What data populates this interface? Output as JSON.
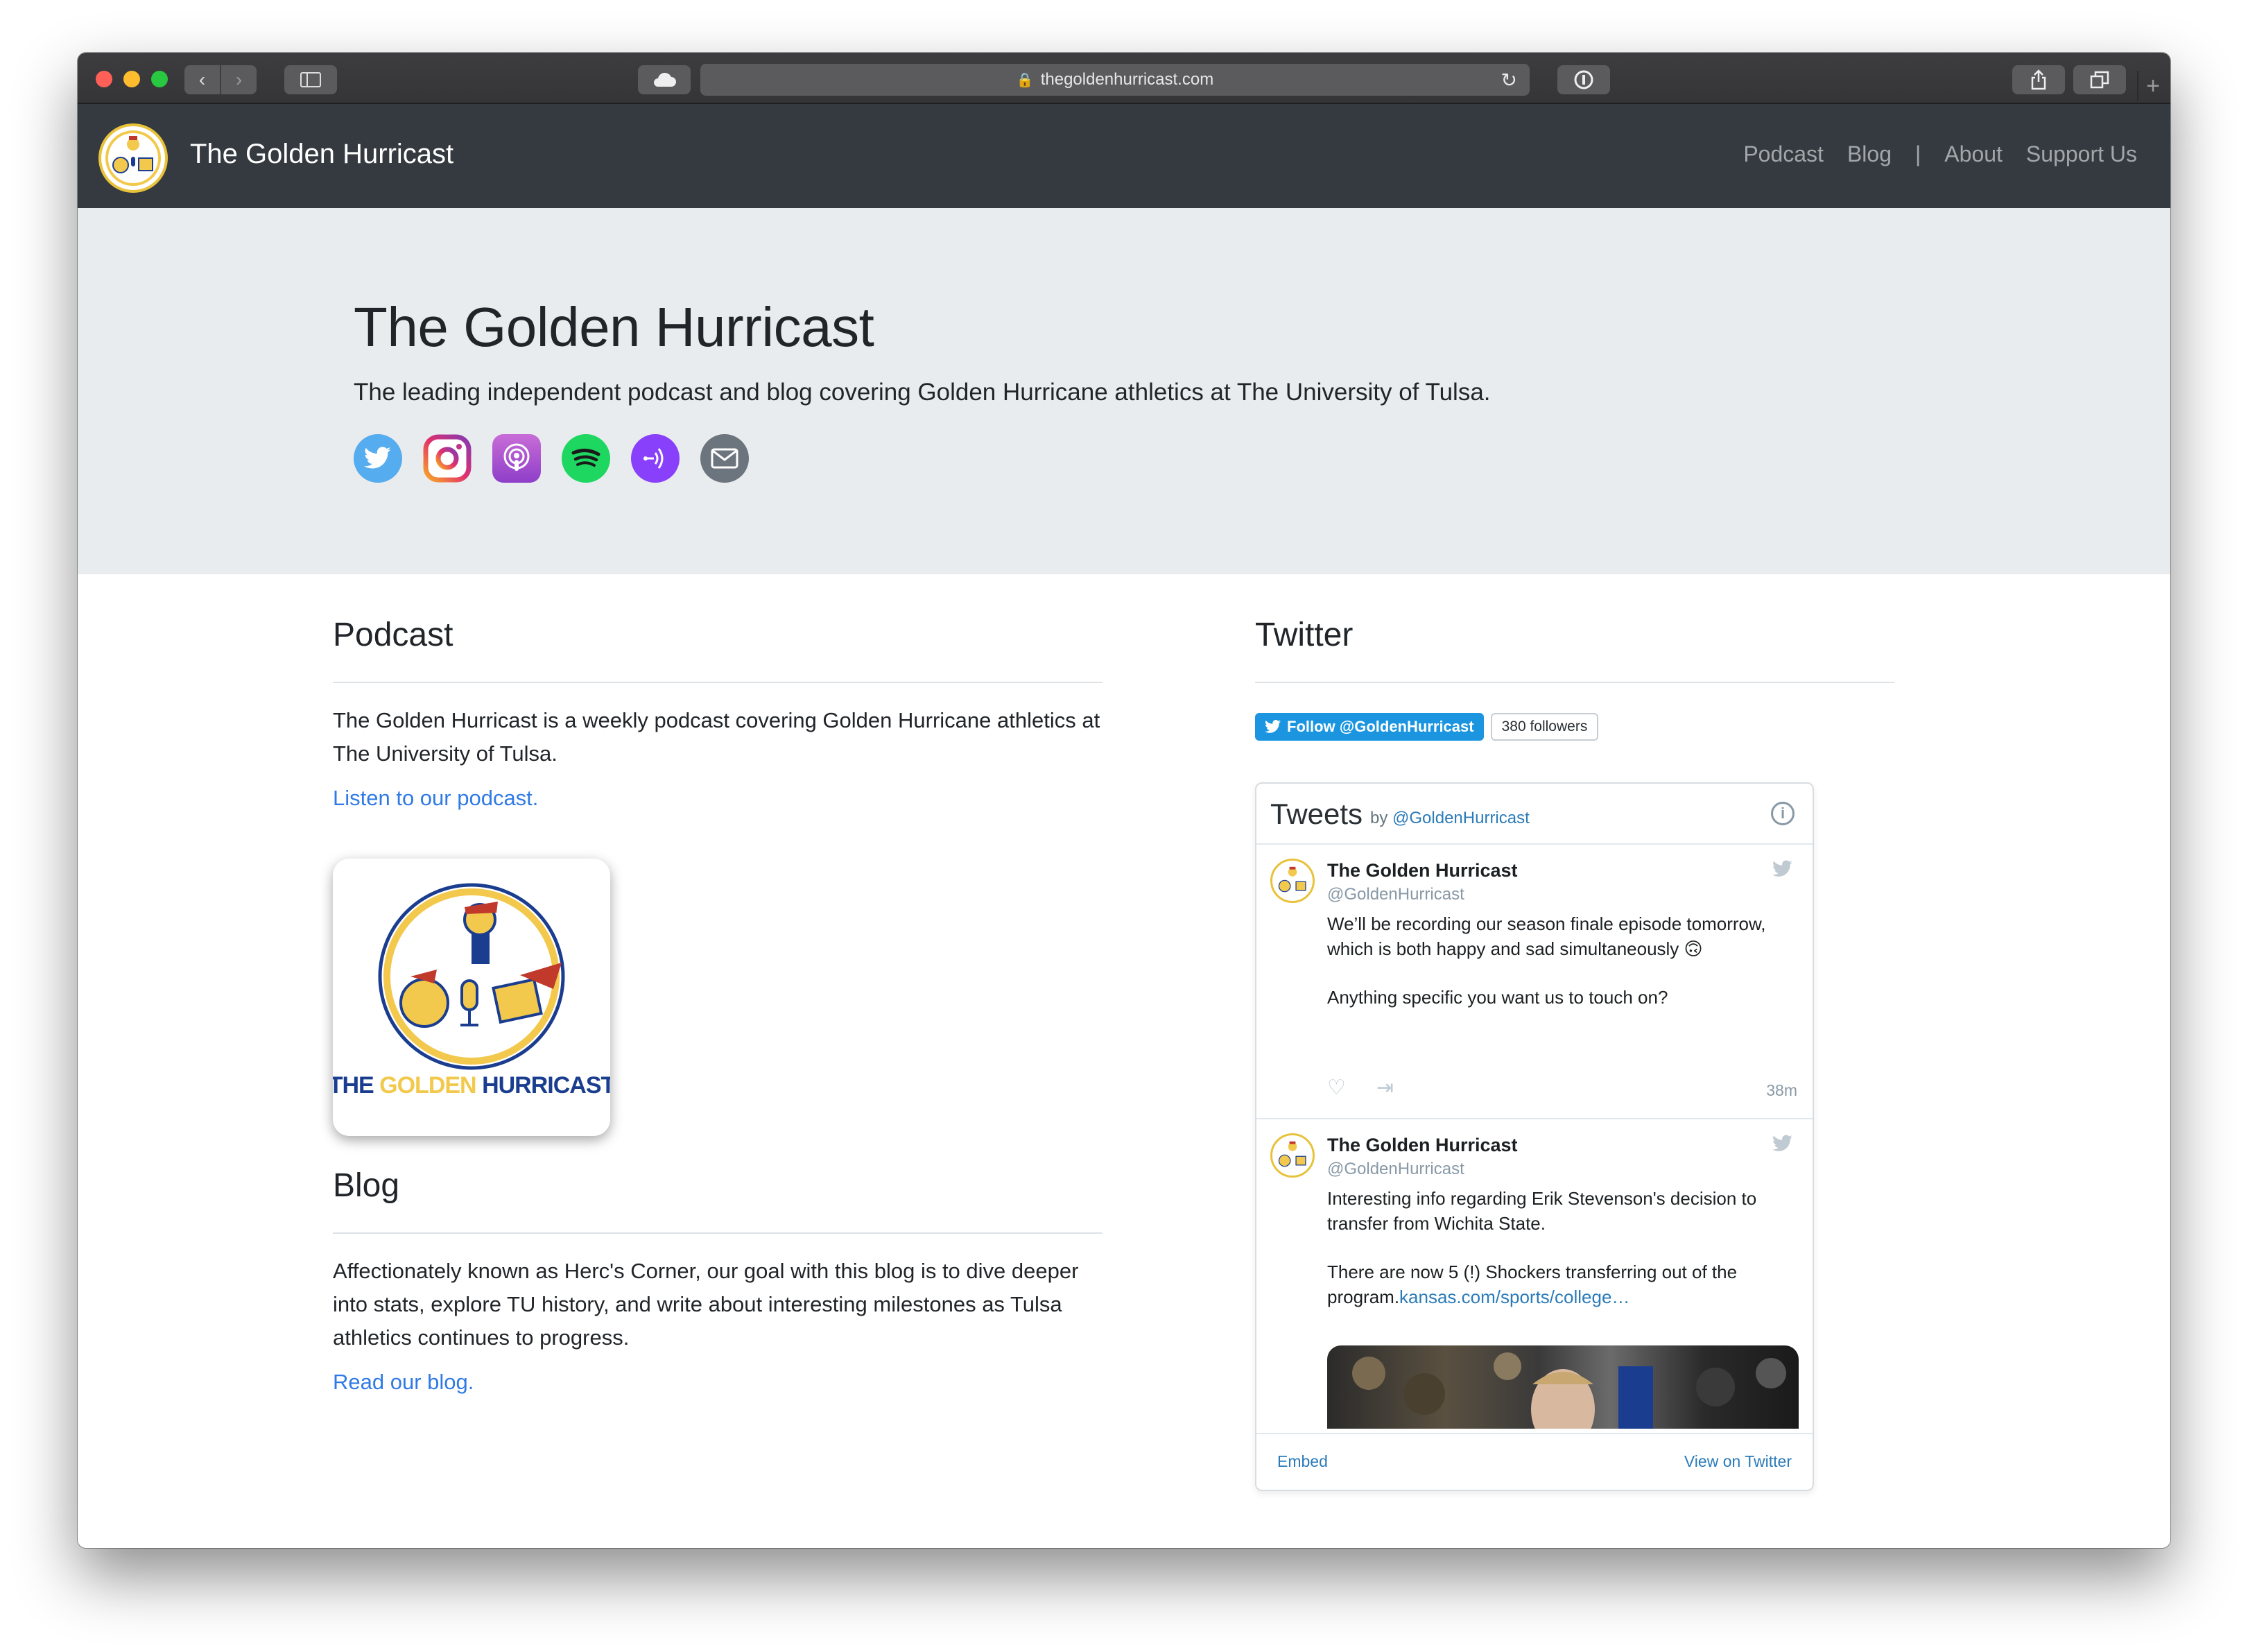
{
  "browser": {
    "url": "thegoldenhurricast.com"
  },
  "navbar": {
    "brand": "The Golden Hurricast",
    "links": [
      "Podcast",
      "Blog",
      "About",
      "Support Us"
    ],
    "separator": "|"
  },
  "hero": {
    "title": "The Golden Hurricast",
    "lead": "The leading independent podcast and blog covering Golden Hurricane athletics at The University of Tulsa.",
    "social_icons": [
      "twitter-icon",
      "instagram-icon",
      "apple-podcasts-icon",
      "spotify-icon",
      "anchor-icon",
      "email-icon"
    ]
  },
  "podcast": {
    "heading": "Podcast",
    "text": "The Golden Hurricast is a weekly podcast covering Golden Hurricane athletics at The University of Tulsa.",
    "link": "Listen to our podcast.",
    "artwork_title_1": "THE ",
    "artwork_title_2": "GOLDEN ",
    "artwork_title_3": "HURRICAST"
  },
  "blog": {
    "heading": "Blog",
    "text": "Affectionately known as Herc's Corner, our goal with this blog is to dive deeper into stats, explore TU history, and write about interesting milestones as Tulsa athletics continues to progress.",
    "link": "Read our blog."
  },
  "twitter": {
    "heading": "Twitter",
    "follow_label": "Follow @GoldenHurricast",
    "followers": "380 followers",
    "timeline_title": "Tweets",
    "timeline_by": "by ",
    "timeline_handle": "@GoldenHurricast",
    "tweets": [
      {
        "name": "The Golden Hurricast",
        "handle": "@GoldenHurricast",
        "text1": "We’ll be recording our season finale episode tomorrow, which is both happy and sad simultaneously 🙃",
        "text2": "Anything specific you want us to touch on?",
        "time": "38m"
      },
      {
        "name": "The Golden Hurricast",
        "handle": "@GoldenHurricast",
        "text1": "Interesting info regarding Erik Stevenson's decision to transfer from Wichita State.",
        "text2": "There are now 5 (!) Shockers transferring out of the program.",
        "link": "kansas.com/sports/college…"
      }
    ],
    "embed": "Embed",
    "view_on": "View on Twitter"
  }
}
